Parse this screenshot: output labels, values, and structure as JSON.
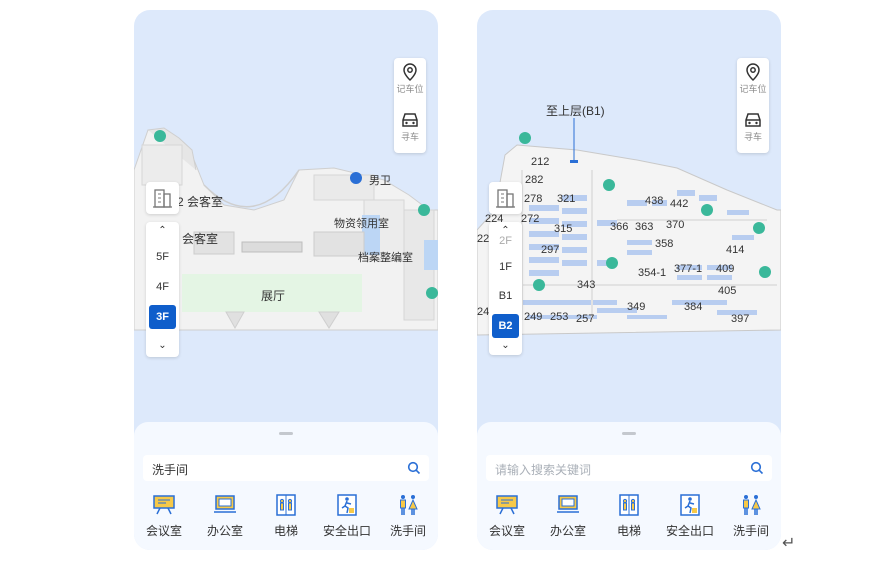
{
  "left": {
    "map_labels": {
      "restroom_male": "男卫",
      "meeting_room_top": "2 会客室",
      "meeting_room_mid": "会客室",
      "supply_room": "物资领用室",
      "archive_room": "档案整编室",
      "exhibition_hall": "展厅"
    },
    "parking": {
      "record_label": "记车位",
      "find_label": "寻车"
    },
    "floors": [
      "5F",
      "4F",
      "3F"
    ],
    "active_floor": "3F",
    "search": {
      "value": "洗手间",
      "placeholder": ""
    },
    "categories": [
      "会议室",
      "办公室",
      "电梯",
      "安全出口",
      "洗手间"
    ]
  },
  "right": {
    "map_labels": {
      "up_sign": "至上层(B1)"
    },
    "rooms": [
      "212",
      "282",
      "278",
      "321",
      "272",
      "315",
      "224",
      "22",
      "297",
      "366",
      "363",
      "438",
      "442",
      "370",
      "358",
      "414",
      "354-1",
      "377-1",
      "409",
      "343",
      "405",
      "349",
      "384",
      "24",
      "249",
      "253",
      "257",
      "397"
    ],
    "parking": {
      "record_label": "记车位",
      "find_label": "寻车"
    },
    "floors": [
      "2F",
      "1F",
      "B1",
      "B2"
    ],
    "active_floor": "B2",
    "search": {
      "value": "",
      "placeholder": "请输入搜索关键词"
    },
    "categories": [
      "会议室",
      "办公室",
      "电梯",
      "安全出口",
      "洗手间"
    ]
  },
  "colors": {
    "accent": "#0f5ecb",
    "icon_blue": "#2a6fd6",
    "teal": "#3ab89a",
    "hall_green": "#e4f5e4"
  },
  "icons": [
    "location-pin-icon",
    "car-icon",
    "building-icon",
    "chevron-up-icon",
    "chevron-down-icon",
    "search-icon",
    "meeting-room-icon",
    "office-icon",
    "elevator-icon",
    "emergency-exit-icon",
    "restroom-icon",
    "return-key-icon"
  ]
}
